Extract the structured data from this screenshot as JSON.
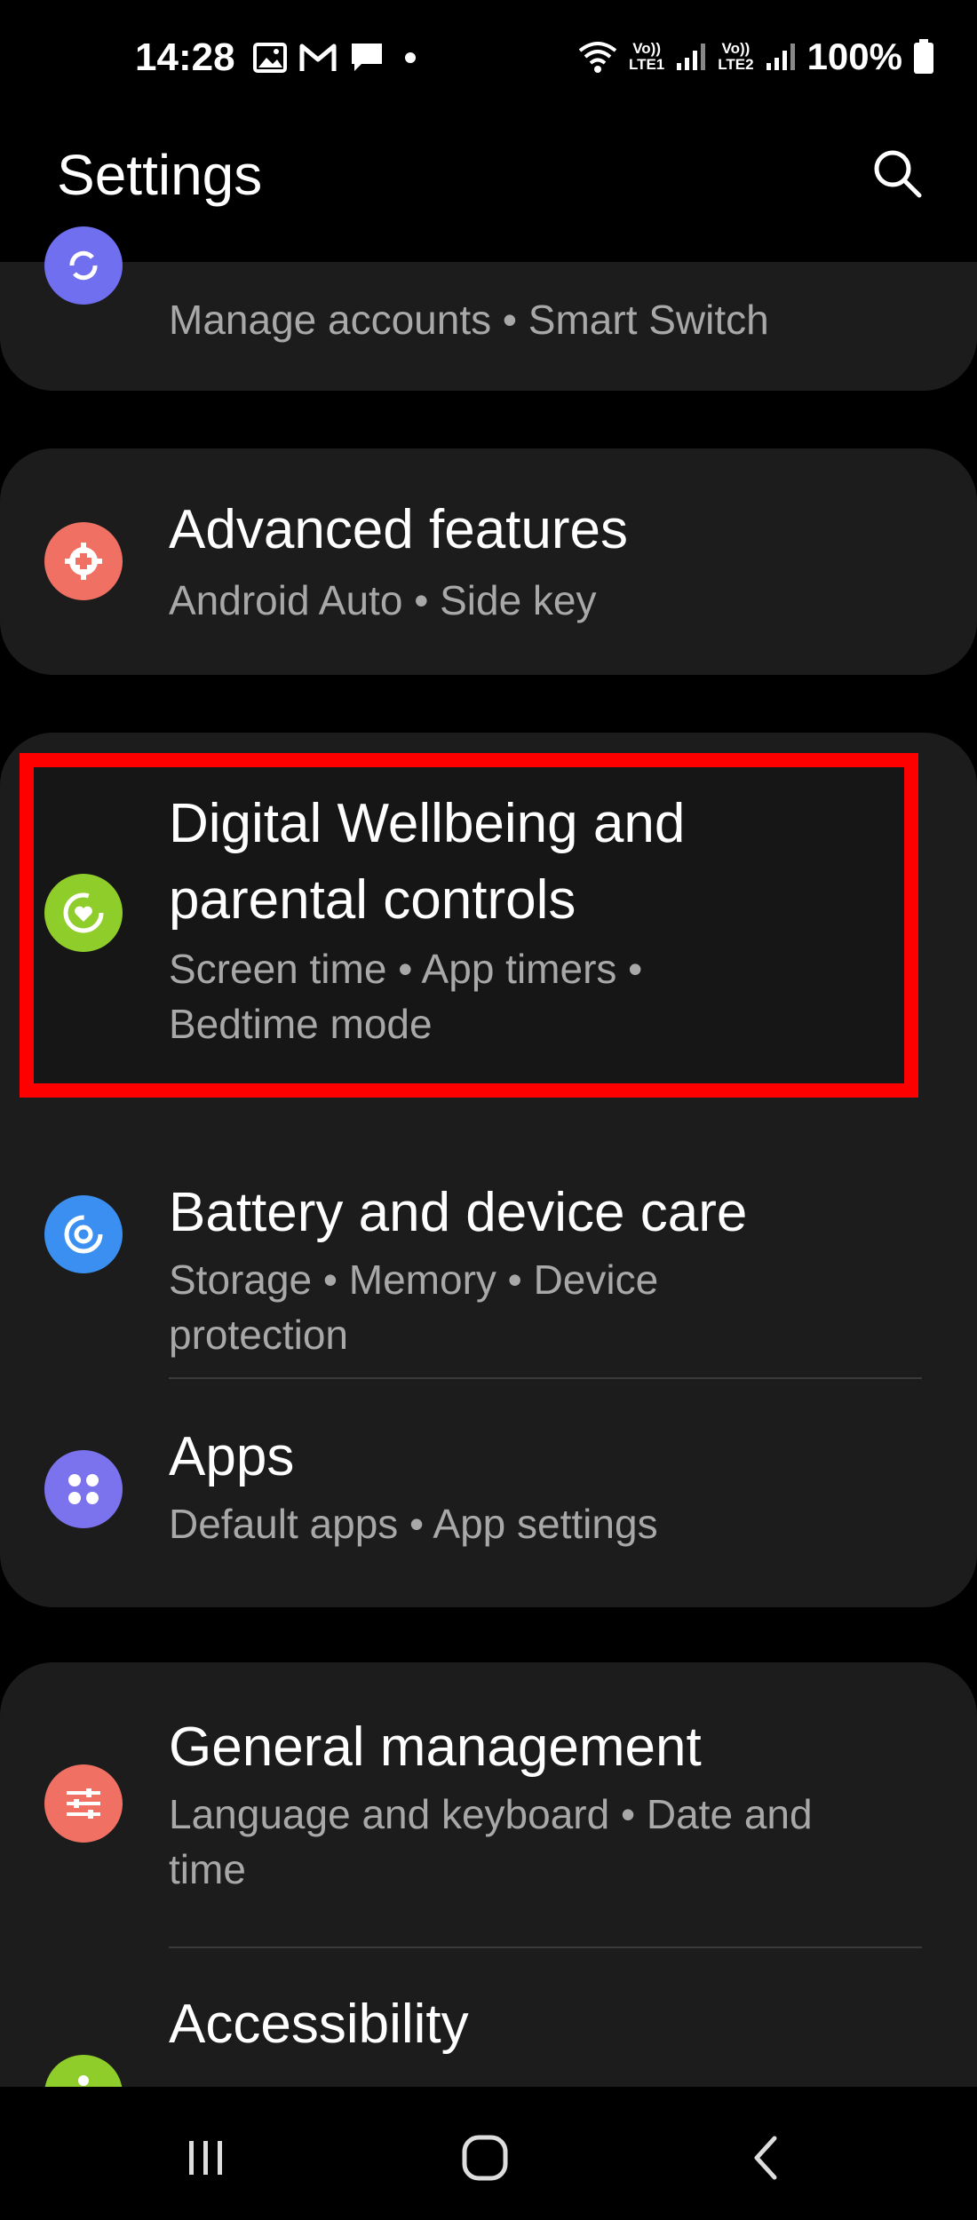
{
  "status_bar": {
    "time": "14:28",
    "lte1": "LTE1",
    "lte2": "LTE2",
    "vo": "Vo))",
    "battery": "100%",
    "icons_left": [
      "gallery-icon",
      "gmail-icon",
      "message-icon",
      "dot-icon"
    ],
    "icons_right": [
      "wifi-icon",
      "signal-icon",
      "battery-icon"
    ]
  },
  "header": {
    "title": "Settings"
  },
  "items": [
    {
      "id": "accounts",
      "subtitle": "Manage accounts  •  Smart Switch",
      "icon": "sync-icon",
      "color": "#6f6ff0"
    },
    {
      "id": "advanced",
      "title": "Advanced features",
      "subtitle": "Android Auto  •  Side key",
      "icon": "gear-plus-icon",
      "color": "#f07163"
    },
    {
      "id": "wellbeing",
      "title_line1": "Digital Wellbeing and",
      "title_line2": "parental controls",
      "subtitle_line1": "Screen time  •  App timers  •",
      "subtitle_line2": "Bedtime mode",
      "icon": "heart-circle-icon",
      "color": "#8fce2a"
    },
    {
      "id": "battery",
      "title": "Battery and device care",
      "subtitle_line1": "Storage  •  Memory  •  Device",
      "subtitle_line2": "protection",
      "icon": "device-care-icon",
      "color": "#3a8ff0"
    },
    {
      "id": "apps",
      "title": "Apps",
      "subtitle": "Default apps  •  App settings",
      "icon": "apps-grid-icon",
      "color": "#7b72ee"
    },
    {
      "id": "general",
      "title": "General management",
      "subtitle_line1": "Language and keyboard  •  Date and",
      "subtitle_line2": "time",
      "icon": "sliders-icon",
      "color": "#f07163"
    },
    {
      "id": "accessibility",
      "title": "Accessibility",
      "icon": "accessibility-icon",
      "color": "#8fce2a"
    }
  ],
  "highlight_color": "#ff0000",
  "nav": {
    "recents": "recents-icon",
    "home": "home-icon",
    "back": "back-icon"
  }
}
